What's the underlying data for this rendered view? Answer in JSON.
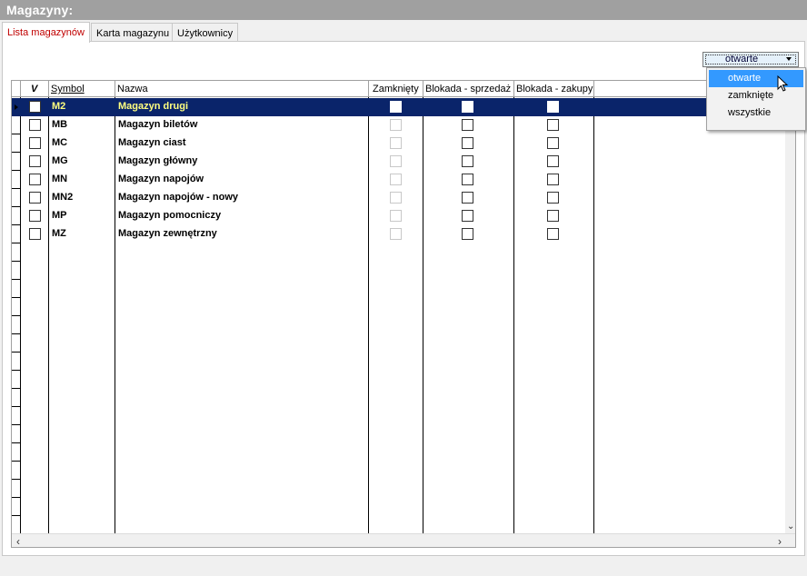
{
  "title": "Magazyny:",
  "tabs": [
    {
      "label": "Lista magazynów",
      "active": true
    },
    {
      "label": "Karta magazynu",
      "active": false
    },
    {
      "label": "Użytkownicy",
      "active": false
    }
  ],
  "filter": {
    "selected": "otwarte",
    "options": [
      "otwarte",
      "zamknięte",
      "wszystkie"
    ]
  },
  "grid": {
    "headers": {
      "check": "V",
      "symbol": "Symbol",
      "nazwa": "Nazwa",
      "zamkniety": "Zamknięty",
      "blokada_sprzedaz": "Blokada - sprzedaż",
      "blokada_zakupy": "Blokada - zakupy"
    },
    "rows": [
      {
        "symbol": "M2",
        "nazwa": "Magazyn drugi"
      },
      {
        "symbol": "MB",
        "nazwa": "Magazyn biletów"
      },
      {
        "symbol": "MC",
        "nazwa": "Magazyn ciast"
      },
      {
        "symbol": "MG",
        "nazwa": "Magazyn główny"
      },
      {
        "symbol": "MN",
        "nazwa": "Magazyn napojów"
      },
      {
        "symbol": "MN2",
        "nazwa": "Magazyn napojów - nowy"
      },
      {
        "symbol": "MP",
        "nazwa": "Magazyn pomocniczy"
      },
      {
        "symbol": "MZ",
        "nazwa": "Magazyn zewnętrzny"
      }
    ],
    "selected_row": 0
  },
  "colors": {
    "titlebar": "#a0a0a0",
    "selection": "#0a246a",
    "selection_text": "#ffff80",
    "active_tab_text": "#c00000",
    "dropdown_highlight": "#3399ff"
  },
  "icons": {
    "row_pointer": "row-pointer-icon",
    "cursor": "mouse-cursor-icon",
    "scroll_left": "chevron-left-icon",
    "scroll_right": "chevron-right-icon",
    "scroll_down": "chevron-down-icon"
  }
}
